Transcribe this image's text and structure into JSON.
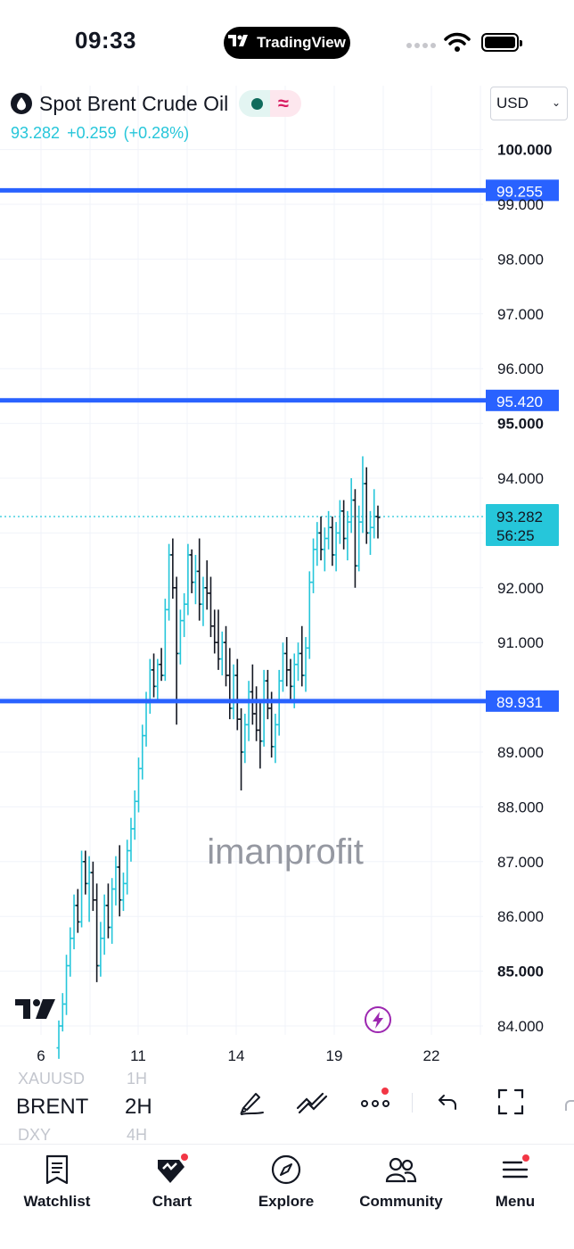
{
  "status_bar": {
    "time": "09:33",
    "app_pill": "TradingView"
  },
  "header": {
    "symbol_name": "Spot Brent Crude Oil",
    "last_price": "93.282",
    "change": "+0.259",
    "change_percent": "(+0.28%)",
    "currency": "USD"
  },
  "chart": {
    "watermark": "imanprofit",
    "price_labels": [
      {
        "text": "100.000",
        "bold": true
      },
      {
        "text": "99.000",
        "bold": false
      },
      {
        "text": "98.000",
        "bold": false
      },
      {
        "text": "97.000",
        "bold": false
      },
      {
        "text": "96.000",
        "bold": false
      },
      {
        "text": "95.000",
        "bold": true
      },
      {
        "text": "94.000",
        "bold": false
      },
      {
        "text": "92.000",
        "bold": false
      },
      {
        "text": "91.000",
        "bold": false
      },
      {
        "text": "89.000",
        "bold": false
      },
      {
        "text": "88.000",
        "bold": false
      },
      {
        "text": "87.000",
        "bold": false
      },
      {
        "text": "86.000",
        "bold": false
      },
      {
        "text": "85.000",
        "bold": true
      },
      {
        "text": "84.000",
        "bold": false
      }
    ],
    "horizontal_levels": [
      "99.255",
      "95.420",
      "89.931"
    ],
    "current_price_tag": {
      "price": "93.282",
      "countdown": "56:25"
    },
    "date_labels": [
      "6",
      "11",
      "14",
      "19",
      "22"
    ]
  },
  "chart_data": {
    "type": "ohlc",
    "title": "Spot Brent Crude Oil",
    "interval": "2H",
    "currency": "USD",
    "ylim": [
      83.8,
      100.3
    ],
    "x_ticks": [
      "6",
      "11",
      "14",
      "19",
      "22"
    ],
    "horizontal_lines": [
      99.255,
      95.42,
      89.931
    ],
    "last_price": 93.282,
    "series": [
      {
        "name": "Spot Brent Crude Oil",
        "ohlc": [
          [
            83.6,
            84.1,
            83.4,
            84.0
          ],
          [
            84.0,
            84.6,
            83.9,
            84.4
          ],
          [
            84.4,
            85.3,
            84.2,
            85.1
          ],
          [
            85.1,
            85.8,
            84.9,
            85.6
          ],
          [
            85.6,
            86.4,
            85.4,
            86.2
          ],
          [
            86.2,
            86.5,
            85.7,
            85.9
          ],
          [
            85.9,
            87.2,
            85.8,
            87.0
          ],
          [
            87.0,
            87.2,
            86.4,
            86.6
          ],
          [
            86.6,
            87.1,
            85.9,
            86.8
          ],
          [
            86.8,
            87.0,
            86.1,
            86.3
          ],
          [
            86.3,
            86.6,
            84.8,
            85.1
          ],
          [
            85.1,
            85.9,
            84.9,
            85.6
          ],
          [
            85.6,
            86.4,
            85.3,
            86.2
          ],
          [
            86.2,
            86.6,
            85.6,
            85.8
          ],
          [
            85.8,
            86.7,
            85.5,
            86.5
          ],
          [
            86.5,
            87.1,
            86.2,
            86.9
          ],
          [
            86.9,
            87.3,
            86.0,
            86.3
          ],
          [
            86.3,
            86.8,
            86.1,
            86.6
          ],
          [
            86.6,
            87.4,
            86.4,
            87.2
          ],
          [
            87.2,
            87.8,
            87.0,
            87.6
          ],
          [
            87.6,
            88.3,
            87.4,
            88.1
          ],
          [
            88.1,
            88.9,
            87.9,
            88.7
          ],
          [
            88.7,
            89.5,
            88.5,
            89.3
          ],
          [
            89.3,
            90.1,
            89.1,
            89.9
          ],
          [
            89.9,
            90.7,
            89.7,
            90.5
          ],
          [
            90.5,
            90.8,
            90.0,
            90.2
          ],
          [
            90.2,
            90.7,
            89.9,
            90.6
          ],
          [
            90.6,
            90.9,
            90.3,
            90.4
          ],
          [
            90.4,
            91.8,
            90.3,
            91.6
          ],
          [
            91.6,
            92.8,
            91.4,
            92.6
          ],
          [
            92.6,
            92.9,
            91.8,
            92.0
          ],
          [
            92.0,
            92.2,
            89.5,
            90.8
          ],
          [
            90.8,
            91.6,
            90.6,
            91.4
          ],
          [
            91.4,
            91.9,
            91.1,
            91.7
          ],
          [
            91.7,
            92.8,
            91.5,
            92.6
          ],
          [
            92.6,
            92.7,
            91.9,
            92.1
          ],
          [
            92.1,
            92.6,
            91.7,
            92.3
          ],
          [
            92.3,
            92.9,
            91.4,
            91.7
          ],
          [
            91.7,
            92.2,
            91.3,
            92.0
          ],
          [
            92.0,
            92.5,
            91.6,
            91.9
          ],
          [
            91.9,
            92.2,
            91.1,
            91.3
          ],
          [
            91.3,
            91.6,
            90.8,
            91.0
          ],
          [
            91.0,
            91.6,
            90.5,
            90.7
          ],
          [
            90.7,
            91.2,
            90.4,
            91.0
          ],
          [
            91.0,
            91.3,
            90.2,
            90.4
          ],
          [
            90.4,
            90.9,
            89.6,
            89.8
          ],
          [
            89.8,
            90.6,
            89.6,
            90.4
          ],
          [
            90.4,
            90.7,
            89.4,
            89.6
          ],
          [
            89.6,
            89.8,
            88.3,
            89.0
          ],
          [
            89.0,
            89.7,
            88.8,
            89.5
          ],
          [
            89.5,
            90.3,
            89.2,
            90.1
          ],
          [
            90.1,
            90.6,
            89.5,
            89.7
          ],
          [
            89.7,
            90.2,
            89.2,
            89.4
          ],
          [
            89.4,
            89.9,
            88.7,
            89.2
          ],
          [
            89.2,
            90.5,
            89.1,
            90.3
          ],
          [
            90.3,
            90.5,
            89.6,
            89.8
          ],
          [
            89.8,
            90.1,
            88.9,
            89.1
          ],
          [
            89.1,
            89.7,
            88.8,
            89.5
          ],
          [
            89.5,
            90.5,
            89.3,
            90.3
          ],
          [
            90.3,
            91.0,
            90.1,
            90.8
          ],
          [
            90.8,
            91.1,
            90.2,
            90.5
          ],
          [
            90.5,
            90.7,
            89.9,
            90.2
          ],
          [
            90.2,
            90.8,
            89.8,
            90.6
          ],
          [
            90.6,
            91.0,
            90.3,
            90.8
          ],
          [
            90.8,
            91.3,
            90.2,
            90.4
          ],
          [
            90.4,
            91.1,
            90.1,
            90.9
          ],
          [
            90.9,
            92.3,
            90.7,
            92.1
          ],
          [
            92.1,
            92.9,
            91.9,
            92.7
          ],
          [
            92.7,
            93.2,
            92.4,
            93.0
          ],
          [
            93.0,
            93.3,
            92.5,
            92.7
          ],
          [
            92.7,
            93.1,
            92.3,
            92.9
          ],
          [
            92.9,
            93.4,
            92.7,
            93.1
          ],
          [
            93.1,
            93.3,
            92.4,
            92.6
          ],
          [
            92.6,
            93.2,
            92.3,
            93.0
          ],
          [
            93.0,
            93.6,
            92.8,
            93.4
          ],
          [
            93.4,
            93.6,
            92.7,
            92.9
          ],
          [
            92.9,
            93.4,
            92.5,
            93.2
          ],
          [
            93.2,
            94.0,
            93.0,
            93.6
          ],
          [
            93.6,
            93.8,
            92.0,
            92.4
          ],
          [
            92.4,
            93.5,
            92.3,
            93.2
          ],
          [
            93.2,
            94.4,
            93.0,
            93.9
          ],
          [
            93.9,
            94.2,
            92.8,
            93.0
          ],
          [
            93.0,
            93.4,
            92.6,
            93.1
          ],
          [
            93.1,
            93.8,
            92.9,
            93.3
          ],
          [
            93.3,
            93.5,
            92.9,
            93.282
          ]
        ]
      }
    ]
  },
  "toolbar": {
    "symbols": [
      "XAUUSD",
      "BRENT",
      "DXY"
    ],
    "intervals": [
      "1H",
      "2H",
      "4H"
    ],
    "buttons": [
      "draw-tool",
      "indicator-tool",
      "more-tool",
      "undo",
      "fullscreen"
    ]
  },
  "nav": {
    "items": [
      {
        "label": "Watchlist",
        "icon": "watchlist-icon"
      },
      {
        "label": "Chart",
        "icon": "chart-icon"
      },
      {
        "label": "Explore",
        "icon": "compass-icon"
      },
      {
        "label": "Community",
        "icon": "people-icon"
      },
      {
        "label": "Menu",
        "icon": "menu-icon"
      }
    ]
  },
  "colors": {
    "accent": "#2962ff",
    "level_line": "#2962ff",
    "candle": "#26c6da",
    "candle_alt": "#131722",
    "price_tag": "#26c6da"
  }
}
